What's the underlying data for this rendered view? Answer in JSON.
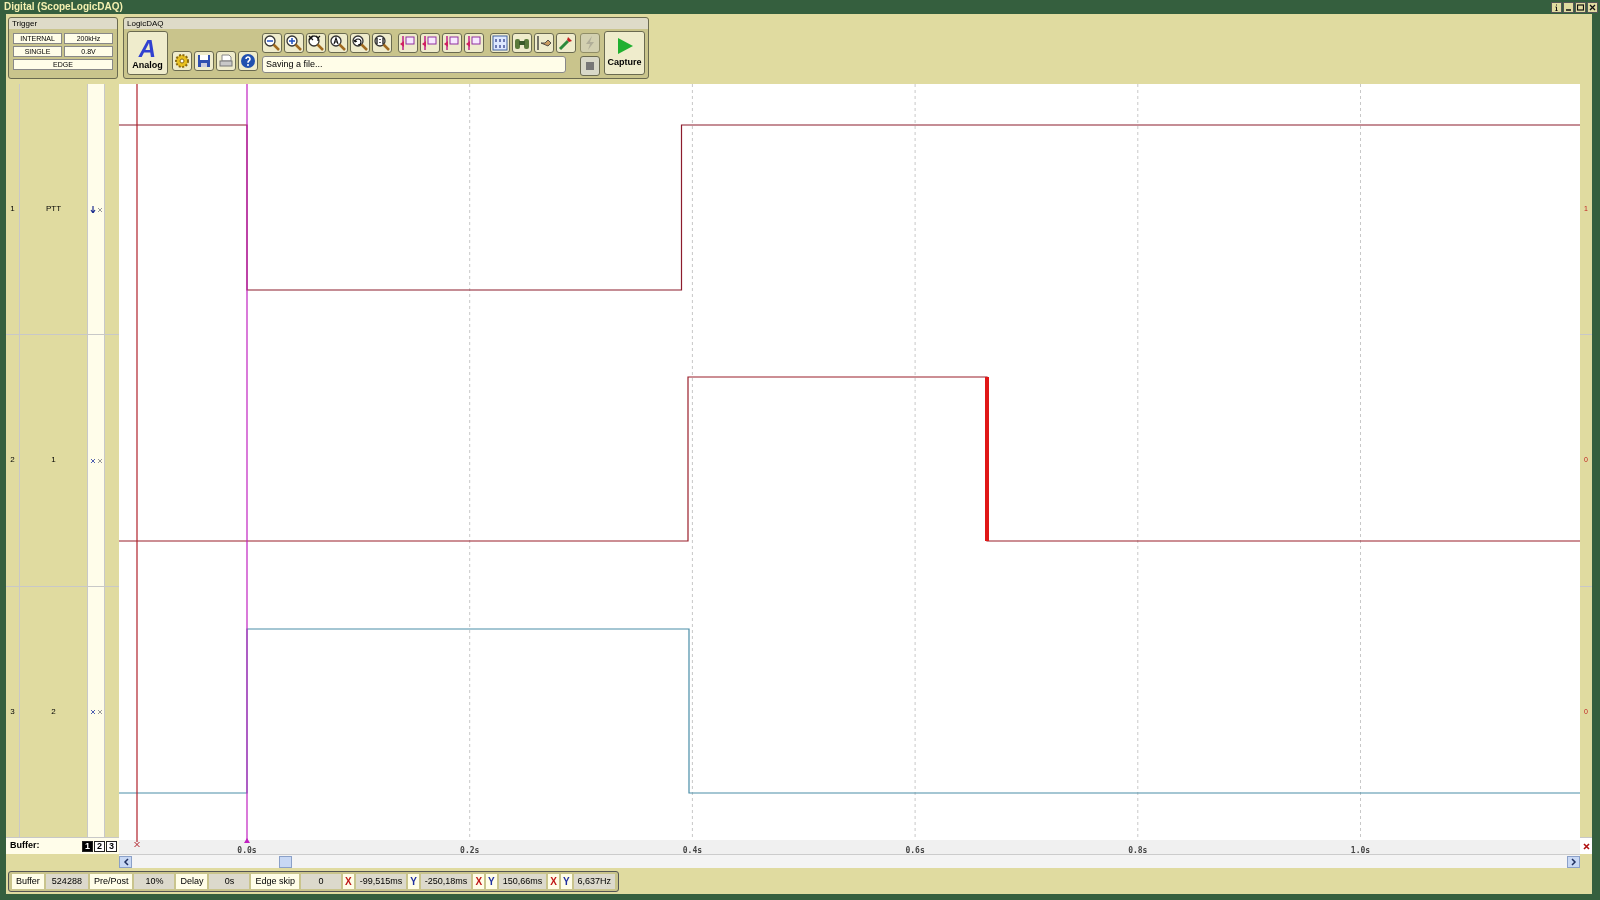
{
  "window": {
    "title": "Digital (ScopeLogicDAQ)"
  },
  "trigger": {
    "title": "Trigger",
    "cells": [
      "INTERNAL",
      "200kHz",
      "SINGLE",
      "0.8V",
      "EDGE"
    ]
  },
  "toolbar": {
    "title": "LogicDAQ",
    "analog": {
      "icon_letter": "A",
      "label": "Analog"
    },
    "tools": [
      {
        "kind": "zoom-out",
        "disabled": false
      },
      {
        "kind": "zoom-in",
        "disabled": false
      },
      {
        "kind": "zoom-xy",
        "disabled": false
      },
      {
        "kind": "zoom-a",
        "disabled": false
      },
      {
        "kind": "zoom-back",
        "disabled": false
      },
      {
        "kind": "zoom-1-1",
        "disabled": false
      },
      {
        "kind": "cursor",
        "disabled": false
      },
      {
        "kind": "cursor",
        "disabled": false
      },
      {
        "kind": "cursor",
        "disabled": false
      },
      {
        "kind": "cursor",
        "disabled": false
      },
      {
        "kind": "binary",
        "disabled": false
      },
      {
        "kind": "binoculars",
        "disabled": false
      },
      {
        "kind": "probe",
        "disabled": false
      },
      {
        "kind": "wrench",
        "disabled": false
      },
      {
        "kind": "lightning",
        "disabled": true
      }
    ],
    "small_tools": [
      {
        "kind": "gear"
      },
      {
        "kind": "save"
      },
      {
        "kind": "print"
      },
      {
        "kind": "help"
      }
    ],
    "status": "Saving a file...",
    "capture": "Capture"
  },
  "channels": [
    {
      "index": "1",
      "name": "PTT",
      "kind": "falling",
      "value": "1"
    },
    {
      "index": "2",
      "name": "1",
      "kind": "plain",
      "value": "0"
    },
    {
      "index": "3",
      "name": "2",
      "kind": "plain",
      "value": "0"
    }
  ],
  "buffer": {
    "label": "Buffer:",
    "buttons": [
      {
        "label": "1",
        "selected": true
      },
      {
        "label": "2",
        "selected": false
      },
      {
        "label": "3",
        "selected": false
      }
    ]
  },
  "time_axis": {
    "labels": [
      "0.0s",
      "0.2s",
      "0.4s",
      "0.6s",
      "0.8s",
      "1.0s"
    ]
  },
  "status_bar": [
    {
      "kind": "pair",
      "label": "Buffer",
      "value": "524288"
    },
    {
      "kind": "pair",
      "label": "Pre/Post",
      "value": "10%"
    },
    {
      "kind": "pair",
      "label": "Delay",
      "value": "0s"
    },
    {
      "kind": "pair",
      "label": "Edge skip",
      "value": "0"
    },
    {
      "kind": "measure",
      "marks": [
        {
          "label": "X",
          "kind": "x"
        }
      ],
      "value": "-99,515ms"
    },
    {
      "kind": "measure",
      "marks": [
        {
          "label": "Y",
          "kind": "y"
        }
      ],
      "value": "-250,18ms"
    },
    {
      "kind": "measure",
      "marks": [
        {
          "label": "X",
          "kind": "x"
        },
        {
          "label": "Y",
          "kind": "y"
        }
      ],
      "value": "150,66ms"
    },
    {
      "kind": "measure",
      "marks": [
        {
          "label": "X",
          "kind": "x"
        },
        {
          "label": "Y",
          "kind": "y"
        }
      ],
      "value": "6,637Hz"
    }
  ]
}
